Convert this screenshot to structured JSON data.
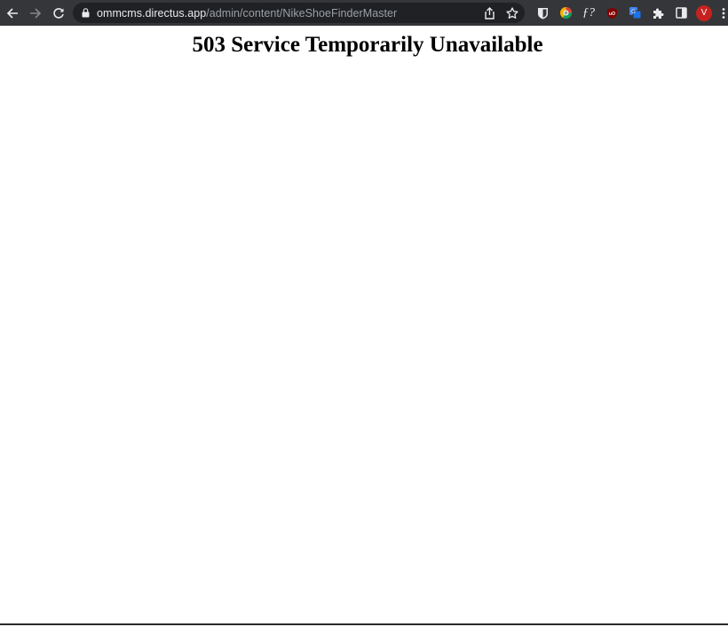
{
  "browser": {
    "url_host": "ommcms.directus.app",
    "url_path": "/admin/content/NikeShoeFinderMaster",
    "nav": {
      "back_icon": "arrow-left-icon",
      "forward_icon": "arrow-right-icon",
      "reload_icon": "reload-icon"
    },
    "omnibox_icons": [
      "share-icon",
      "star-icon"
    ],
    "extensions": [
      "bitwarden-icon",
      "colorful-extension-icon",
      "font-finder-icon",
      "ublock-icon",
      "translate-icon",
      "puzzle-icon",
      "side-panel-icon"
    ],
    "profile_initial": "V",
    "colors": {
      "toolbar": "#35363a",
      "omnibox": "#202124",
      "avatar": "#c5221f"
    }
  },
  "page": {
    "heading": "503 Service Temporarily Unavailable"
  }
}
